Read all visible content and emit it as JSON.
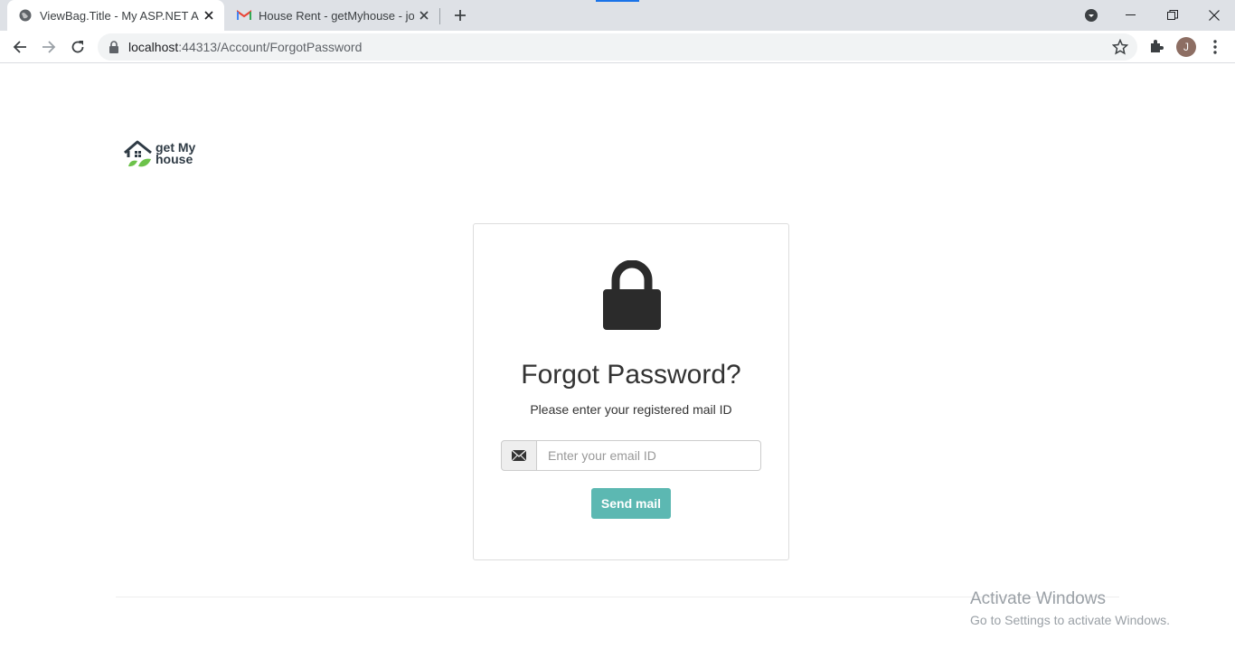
{
  "browser": {
    "tabs": [
      {
        "title": "ViewBag.Title - My ASP.NET Application",
        "active": true
      },
      {
        "title": "House Rent - getMyhouse - jothi",
        "active": false
      }
    ],
    "url_host": "localhost",
    "url_rest": ":44313/Account/ForgotPassword",
    "avatar_letter": "J"
  },
  "logo": {
    "line1": "get My",
    "line2": "house"
  },
  "form": {
    "title": "Forgot Password?",
    "subtitle": "Please enter your registered mail ID",
    "email_placeholder": "Enter your email ID",
    "email_value": "",
    "submit_label": "Send mail"
  },
  "watermark": {
    "line1": "Activate Windows",
    "line2": "Go to Settings to activate Windows."
  },
  "colors": {
    "accent_button": "#5cb8b2",
    "tabstrip": "#dee1e6",
    "logo_dark": "#2f3b45",
    "logo_green": "#6cc24a"
  }
}
